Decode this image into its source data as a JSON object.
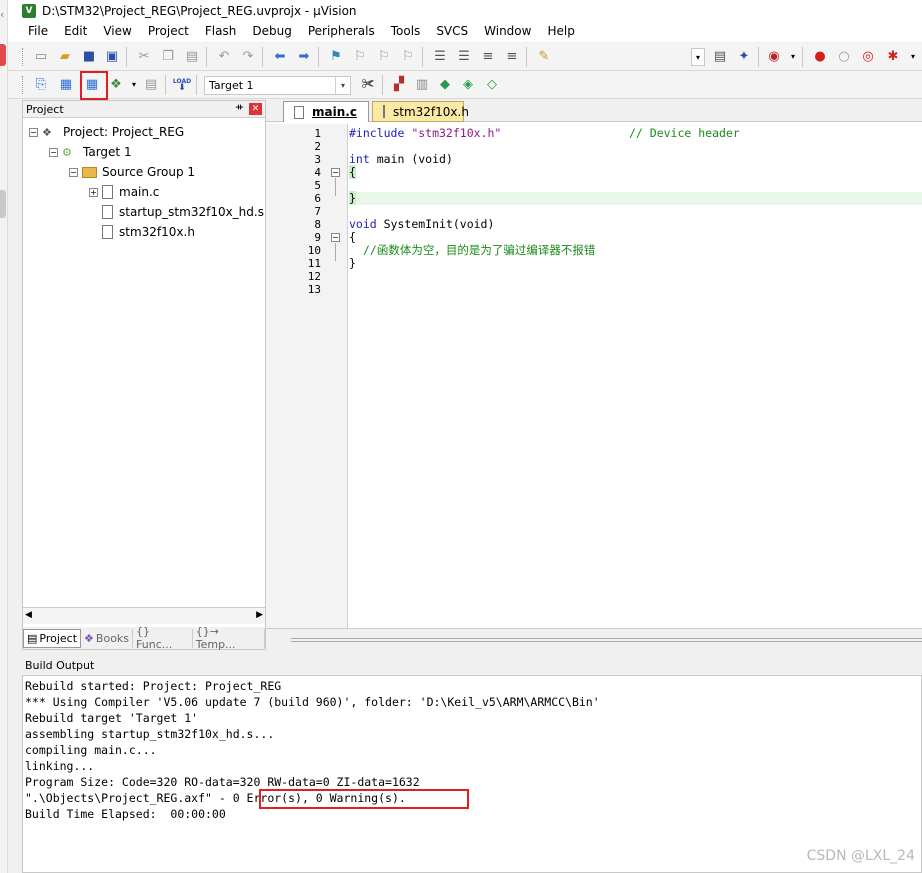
{
  "window": {
    "title": "D:\\STM32\\Project_REG\\Project_REG.uvprojx - µVision",
    "app_icon": "V"
  },
  "menu": [
    "File",
    "Edit",
    "View",
    "Project",
    "Flash",
    "Debug",
    "Peripherals",
    "Tools",
    "SVCS",
    "Window",
    "Help"
  ],
  "toolbar2": {
    "target_label": "Target 1",
    "load_label": "LOAD"
  },
  "project_panel": {
    "title": "Project",
    "tree": {
      "project": "Project: Project_REG",
      "target": "Target 1",
      "group": "Source Group 1",
      "files": [
        "main.c",
        "startup_stm32f10x_hd.s",
        "stm32f10x.h"
      ]
    },
    "tabs": [
      "Project",
      "Books",
      "{} Func...",
      "{}→ Temp..."
    ]
  },
  "editor": {
    "tabs": [
      "main.c",
      "stm32f10x.h"
    ],
    "active_tab": "main.c",
    "line_numbers": [
      "1",
      "2",
      "3",
      "4",
      "5",
      "6",
      "7",
      "8",
      "9",
      "10",
      "11",
      "12",
      "13"
    ],
    "lines": {
      "l1_directive": "#include ",
      "l1_string": "\"stm32f10x.h\"",
      "l1_comment": "// Device header",
      "l3_kw": "int",
      "l3_rest": " main (void)",
      "l4": "{",
      "l6": "}",
      "l8_kw": "void",
      "l8_rest": " SystemInit(void)",
      "l9": "{",
      "l10_comment": "//函数体为空，目的是为了骗过编译器不报错",
      "l11": "}"
    }
  },
  "build_output": {
    "title": "Build Output",
    "lines": [
      "Rebuild started: Project: Project_REG",
      "*** Using Compiler 'V5.06 update 7 (build 960)', folder: 'D:\\Keil_v5\\ARM\\ARMCC\\Bin'",
      "Rebuild target 'Target 1'",
      "assembling startup_stm32f10x_hd.s...",
      "compiling main.c...",
      "linking...",
      "Program Size: Code=320 RO-data=320 RW-data=0 ZI-data=1632",
      "\".\\Objects\\Project_REG.axf\" - 0 Error(s), 0 Warning(s).",
      "Build Time Elapsed:  00:00:00"
    ]
  },
  "watermark": "CSDN @LXL_24",
  "colors": {
    "highlight_red": "#e02020",
    "keyword_blue": "#1d1dbf",
    "comment_green": "#1a8a1a",
    "active_tab_yellow": "#fbe9a6"
  }
}
